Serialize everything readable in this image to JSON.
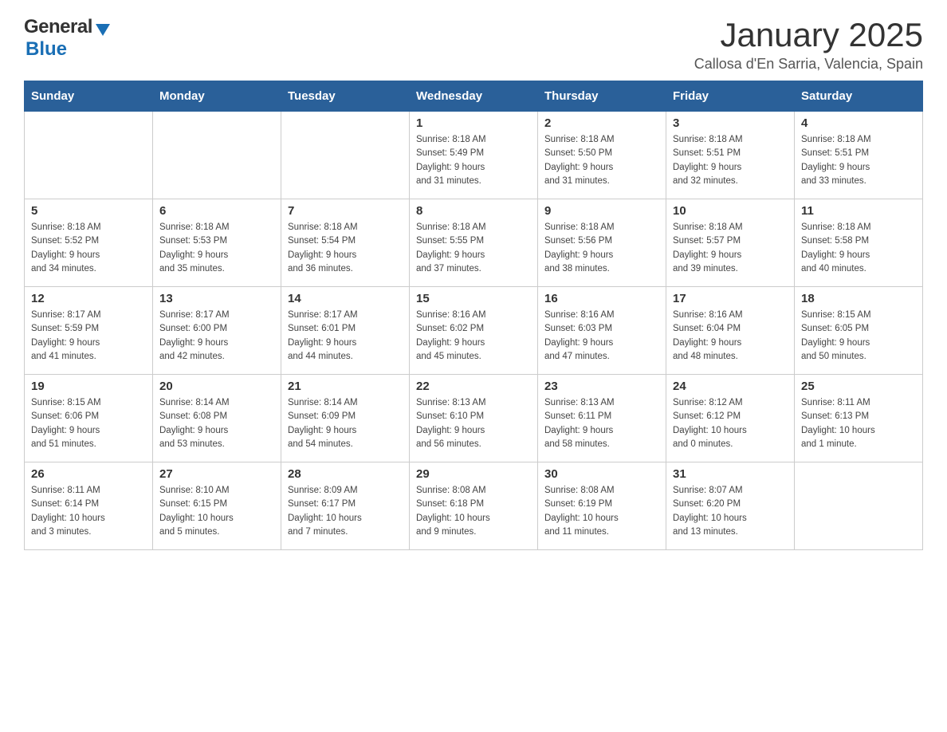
{
  "header": {
    "logo": {
      "text_general": "General",
      "arrow_icon": "triangle-down",
      "text_blue": "Blue"
    },
    "title": "January 2025",
    "location": "Callosa d'En Sarria, Valencia, Spain"
  },
  "calendar": {
    "days_of_week": [
      "Sunday",
      "Monday",
      "Tuesday",
      "Wednesday",
      "Thursday",
      "Friday",
      "Saturday"
    ],
    "weeks": [
      {
        "days": [
          {
            "date": "",
            "info": ""
          },
          {
            "date": "",
            "info": ""
          },
          {
            "date": "",
            "info": ""
          },
          {
            "date": "1",
            "info": "Sunrise: 8:18 AM\nSunset: 5:49 PM\nDaylight: 9 hours\nand 31 minutes."
          },
          {
            "date": "2",
            "info": "Sunrise: 8:18 AM\nSunset: 5:50 PM\nDaylight: 9 hours\nand 31 minutes."
          },
          {
            "date": "3",
            "info": "Sunrise: 8:18 AM\nSunset: 5:51 PM\nDaylight: 9 hours\nand 32 minutes."
          },
          {
            "date": "4",
            "info": "Sunrise: 8:18 AM\nSunset: 5:51 PM\nDaylight: 9 hours\nand 33 minutes."
          }
        ]
      },
      {
        "days": [
          {
            "date": "5",
            "info": "Sunrise: 8:18 AM\nSunset: 5:52 PM\nDaylight: 9 hours\nand 34 minutes."
          },
          {
            "date": "6",
            "info": "Sunrise: 8:18 AM\nSunset: 5:53 PM\nDaylight: 9 hours\nand 35 minutes."
          },
          {
            "date": "7",
            "info": "Sunrise: 8:18 AM\nSunset: 5:54 PM\nDaylight: 9 hours\nand 36 minutes."
          },
          {
            "date": "8",
            "info": "Sunrise: 8:18 AM\nSunset: 5:55 PM\nDaylight: 9 hours\nand 37 minutes."
          },
          {
            "date": "9",
            "info": "Sunrise: 8:18 AM\nSunset: 5:56 PM\nDaylight: 9 hours\nand 38 minutes."
          },
          {
            "date": "10",
            "info": "Sunrise: 8:18 AM\nSunset: 5:57 PM\nDaylight: 9 hours\nand 39 minutes."
          },
          {
            "date": "11",
            "info": "Sunrise: 8:18 AM\nSunset: 5:58 PM\nDaylight: 9 hours\nand 40 minutes."
          }
        ]
      },
      {
        "days": [
          {
            "date": "12",
            "info": "Sunrise: 8:17 AM\nSunset: 5:59 PM\nDaylight: 9 hours\nand 41 minutes."
          },
          {
            "date": "13",
            "info": "Sunrise: 8:17 AM\nSunset: 6:00 PM\nDaylight: 9 hours\nand 42 minutes."
          },
          {
            "date": "14",
            "info": "Sunrise: 8:17 AM\nSunset: 6:01 PM\nDaylight: 9 hours\nand 44 minutes."
          },
          {
            "date": "15",
            "info": "Sunrise: 8:16 AM\nSunset: 6:02 PM\nDaylight: 9 hours\nand 45 minutes."
          },
          {
            "date": "16",
            "info": "Sunrise: 8:16 AM\nSunset: 6:03 PM\nDaylight: 9 hours\nand 47 minutes."
          },
          {
            "date": "17",
            "info": "Sunrise: 8:16 AM\nSunset: 6:04 PM\nDaylight: 9 hours\nand 48 minutes."
          },
          {
            "date": "18",
            "info": "Sunrise: 8:15 AM\nSunset: 6:05 PM\nDaylight: 9 hours\nand 50 minutes."
          }
        ]
      },
      {
        "days": [
          {
            "date": "19",
            "info": "Sunrise: 8:15 AM\nSunset: 6:06 PM\nDaylight: 9 hours\nand 51 minutes."
          },
          {
            "date": "20",
            "info": "Sunrise: 8:14 AM\nSunset: 6:08 PM\nDaylight: 9 hours\nand 53 minutes."
          },
          {
            "date": "21",
            "info": "Sunrise: 8:14 AM\nSunset: 6:09 PM\nDaylight: 9 hours\nand 54 minutes."
          },
          {
            "date": "22",
            "info": "Sunrise: 8:13 AM\nSunset: 6:10 PM\nDaylight: 9 hours\nand 56 minutes."
          },
          {
            "date": "23",
            "info": "Sunrise: 8:13 AM\nSunset: 6:11 PM\nDaylight: 9 hours\nand 58 minutes."
          },
          {
            "date": "24",
            "info": "Sunrise: 8:12 AM\nSunset: 6:12 PM\nDaylight: 10 hours\nand 0 minutes."
          },
          {
            "date": "25",
            "info": "Sunrise: 8:11 AM\nSunset: 6:13 PM\nDaylight: 10 hours\nand 1 minute."
          }
        ]
      },
      {
        "days": [
          {
            "date": "26",
            "info": "Sunrise: 8:11 AM\nSunset: 6:14 PM\nDaylight: 10 hours\nand 3 minutes."
          },
          {
            "date": "27",
            "info": "Sunrise: 8:10 AM\nSunset: 6:15 PM\nDaylight: 10 hours\nand 5 minutes."
          },
          {
            "date": "28",
            "info": "Sunrise: 8:09 AM\nSunset: 6:17 PM\nDaylight: 10 hours\nand 7 minutes."
          },
          {
            "date": "29",
            "info": "Sunrise: 8:08 AM\nSunset: 6:18 PM\nDaylight: 10 hours\nand 9 minutes."
          },
          {
            "date": "30",
            "info": "Sunrise: 8:08 AM\nSunset: 6:19 PM\nDaylight: 10 hours\nand 11 minutes."
          },
          {
            "date": "31",
            "info": "Sunrise: 8:07 AM\nSunset: 6:20 PM\nDaylight: 10 hours\nand 13 minutes."
          },
          {
            "date": "",
            "info": ""
          }
        ]
      }
    ]
  }
}
